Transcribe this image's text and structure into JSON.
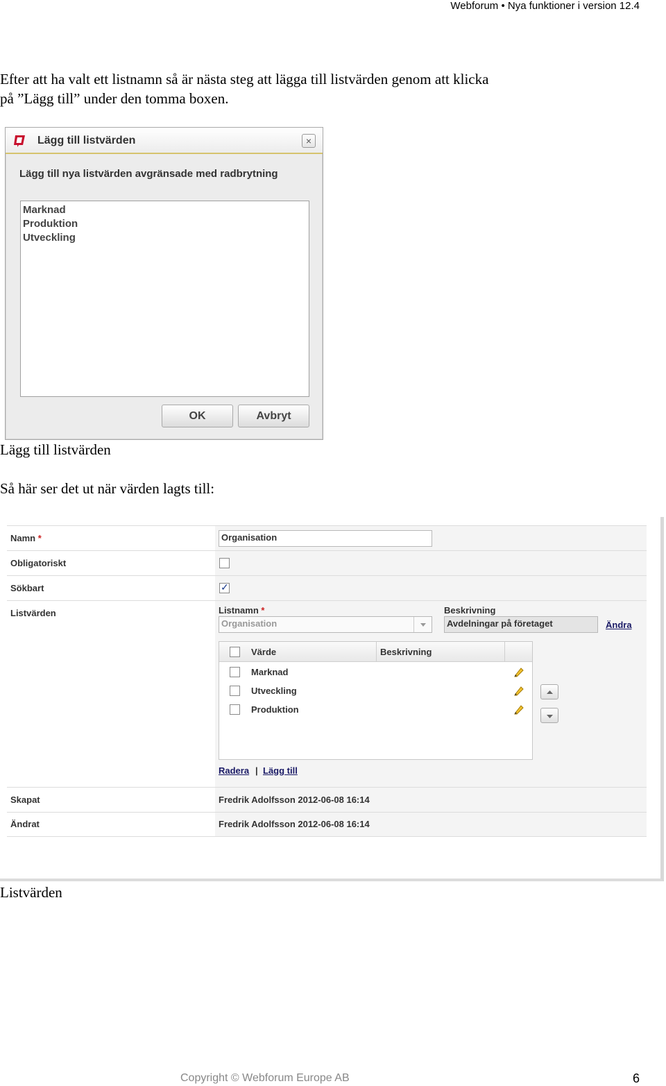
{
  "header": {
    "running_title": "Webforum • Nya funktioner i version 12.4"
  },
  "intro": {
    "line1": "Efter att ha valt ett listnamn så är nästa steg att lägga till listvärden genom att klicka",
    "line2": "på ”Lägg till” under den tomma boxen."
  },
  "dialog": {
    "title": "Lägg till listvärden",
    "close_glyph": "×",
    "instruction": "Lägg till nya listvärden avgränsade med radbrytning",
    "entries": [
      "Marknad",
      "Produktion",
      "Utveckling"
    ],
    "ok_label": "OK",
    "cancel_label": "Avbryt"
  },
  "caption1": "Lägg till listvärden",
  "intro2": "Så här ser det ut när värden lagts till:",
  "form": {
    "name_label": "Namn",
    "required_mark": "*",
    "name_value": "Organisation",
    "mandatory_label": "Obligatoriskt",
    "mandatory_checked": false,
    "searchable_label": "Sökbart",
    "searchable_checked": true,
    "listvalues_label": "Listvärden",
    "listname_label": "Listnamn",
    "listname_value": "Organisation",
    "description_label": "Beskrivning",
    "description_value": "Avdelningar på företaget",
    "change_link": "Ändra",
    "grid": {
      "col_value": "Värde",
      "col_description": "Beskrivning",
      "rows": [
        "Marknad",
        "Utveckling",
        "Produktion"
      ]
    },
    "delete_link": "Radera",
    "separator": "|",
    "add_link": "Lägg till",
    "created_label": "Skapat",
    "created_value": "Fredrik Adolfsson 2012-06-08 16:14",
    "changed_label": "Ändrat",
    "changed_value": "Fredrik Adolfsson 2012-06-08 16:14"
  },
  "caption2": "Listvärden",
  "footer": {
    "copyright": "Copyright © Webforum Europe AB",
    "page_number": "6"
  },
  "icons": {
    "logo": "webforum-logo-icon",
    "close": "close-icon",
    "pencil": "pencil-icon",
    "arrow_up": "arrow-up-icon",
    "arrow_down": "arrow-down-icon",
    "dropdown": "chevron-down-icon"
  },
  "colors": {
    "accent": "#c8102e",
    "link": "#1a1a66",
    "required": "#cc2222"
  }
}
